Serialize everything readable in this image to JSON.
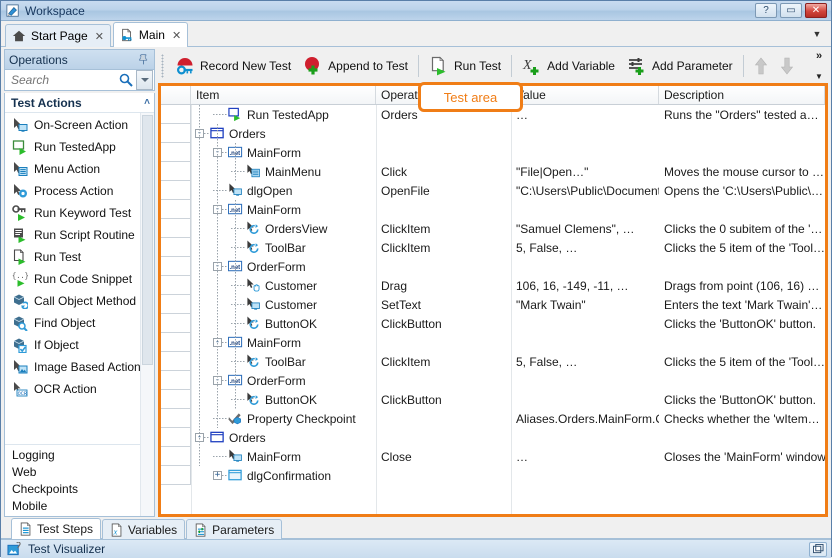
{
  "window": {
    "title": "Workspace",
    "icon": "pencil-document-icon",
    "buttons": [
      {
        "name": "help-button",
        "label": "?"
      },
      {
        "name": "restore-button",
        "label": "▭"
      },
      {
        "name": "close-button",
        "label": "✕"
      }
    ]
  },
  "tabs": [
    {
      "name": "tab-start-page",
      "label": "Start Page",
      "icon": "home-icon",
      "active": false,
      "close": "✕"
    },
    {
      "name": "tab-main",
      "label": "Main",
      "icon": "keyword-test-icon",
      "active": true,
      "close": "✕"
    }
  ],
  "tabstrip_caret": "▼",
  "operations_panel": {
    "title": "Operations",
    "pin_icon": "pin-icon",
    "search": {
      "value": "",
      "placeholder": "Search",
      "icon": "magnifier-icon",
      "dropdown": "▼"
    },
    "group_title": "Test Actions",
    "group_chevron": "˄",
    "items": [
      {
        "label": "On-Screen Action",
        "icon": "cursor-screen-icon"
      },
      {
        "label": "Run TestedApp",
        "icon": "run-app-icon"
      },
      {
        "label": "Menu Action",
        "icon": "cursor-menu-icon"
      },
      {
        "label": "Process Action",
        "icon": "cursor-gear-icon"
      },
      {
        "label": "Run Keyword Test",
        "icon": "key-run-icon"
      },
      {
        "label": "Run Script Routine",
        "icon": "script-run-icon"
      },
      {
        "label": "Run Test",
        "icon": "page-run-icon"
      },
      {
        "label": "Run Code Snippet",
        "icon": "code-run-icon"
      },
      {
        "label": "Call Object Method",
        "icon": "object-method-icon"
      },
      {
        "label": "Find Object",
        "icon": "object-find-icon"
      },
      {
        "label": "If Object",
        "icon": "object-if-icon"
      },
      {
        "label": "Image Based Action",
        "icon": "cursor-image-icon"
      },
      {
        "label": "OCR Action",
        "icon": "cursor-ocr-icon"
      }
    ],
    "footer_groups": [
      {
        "label": "Logging"
      },
      {
        "label": "Web"
      },
      {
        "label": "Checkpoints"
      },
      {
        "label": "Mobile"
      }
    ],
    "footer_chevron": "˅"
  },
  "toolbar": {
    "buttons": [
      {
        "name": "record-new-test-button",
        "label": "Record New Test",
        "icon": "record-key-icon"
      },
      {
        "name": "append-to-test-button",
        "label": "Append to Test",
        "icon": "append-plus-icon"
      },
      {
        "name": "run-test-button",
        "label": "Run Test",
        "icon": "page-run-icon"
      },
      {
        "name": "add-variable-button",
        "label": "Add Variable",
        "icon": "variable-x-plus-icon"
      },
      {
        "name": "add-parameter-button",
        "label": "Add Parameter",
        "icon": "parameter-sliders-plus-icon"
      }
    ],
    "move_up": {
      "name": "move-up-button",
      "icon": "arrow-up-icon"
    },
    "move_down": {
      "name": "move-down-button",
      "icon": "arrow-down-icon"
    },
    "overflow": {
      "double_chevron": "»",
      "down_caret": "▼"
    }
  },
  "callout": {
    "text": "Test area",
    "color": "#f07d16"
  },
  "grid": {
    "columns": [
      "Item",
      "Operation",
      "Value",
      "Description"
    ],
    "rows": [
      {
        "indent": 1,
        "expander": "",
        "icon": "run-app-icon",
        "item": "Run TestedApp",
        "operation": "Orders",
        "value": "…",
        "description": "Runs the \"Orders\" tested a…"
      },
      {
        "indent": 0,
        "expander": "-",
        "icon": "window-icon",
        "item": "Orders",
        "operation": "",
        "value": "",
        "description": ""
      },
      {
        "indent": 1,
        "expander": "-",
        "icon": "dotnet-icon",
        "item": "MainForm",
        "operation": "",
        "value": "",
        "description": ""
      },
      {
        "indent": 2,
        "expander": "",
        "icon": "cursor-menu-icon",
        "item": "MainMenu",
        "operation": "Click",
        "value": "\"File|Open…\"",
        "description": "Moves the mouse cursor to …"
      },
      {
        "indent": 1,
        "expander": "",
        "icon": "cursor-screen-icon",
        "item": "dlgOpen",
        "operation": "OpenFile",
        "value": "\"C:\\Users\\Public\\Documents…",
        "description": "Opens the 'C:\\Users\\Public\\…"
      },
      {
        "indent": 1,
        "expander": "-",
        "icon": "dotnet-icon",
        "item": "MainForm",
        "operation": "",
        "value": "",
        "description": ""
      },
      {
        "indent": 2,
        "expander": "",
        "icon": "cursor-click-icon",
        "item": "OrdersView",
        "operation": "ClickItem",
        "value": "\"Samuel Clemens\", …",
        "description": "Clicks the 0 subitem of the '…"
      },
      {
        "indent": 2,
        "expander": "",
        "icon": "cursor-click-icon",
        "item": "ToolBar",
        "operation": "ClickItem",
        "value": "5, False, …",
        "description": "Clicks the 5 item of the 'Tool…"
      },
      {
        "indent": 1,
        "expander": "-",
        "icon": "dotnet-icon",
        "item": "OrderForm",
        "operation": "",
        "value": "",
        "description": ""
      },
      {
        "indent": 2,
        "expander": "",
        "icon": "cursor-drag-icon",
        "item": "Customer",
        "operation": "Drag",
        "value": "106, 16, -149, -11, …",
        "description": "Drags from point (106, 16) …"
      },
      {
        "indent": 2,
        "expander": "",
        "icon": "cursor-screen-icon",
        "item": "Customer",
        "operation": "SetText",
        "value": "\"Mark Twain\"",
        "description": "Enters the text 'Mark Twain'…"
      },
      {
        "indent": 2,
        "expander": "",
        "icon": "cursor-click-icon",
        "item": "ButtonOK",
        "operation": "ClickButton",
        "value": "",
        "description": "Clicks the 'ButtonOK' button."
      },
      {
        "indent": 1,
        "expander": "-",
        "icon": "dotnet-icon",
        "item": "MainForm",
        "operation": "",
        "value": "",
        "description": ""
      },
      {
        "indent": 2,
        "expander": "",
        "icon": "cursor-click-icon",
        "item": "ToolBar",
        "operation": "ClickItem",
        "value": "5, False, …",
        "description": "Clicks the 5 item of the 'Tool…"
      },
      {
        "indent": 1,
        "expander": "-",
        "icon": "dotnet-icon",
        "item": "OrderForm",
        "operation": "",
        "value": "",
        "description": ""
      },
      {
        "indent": 2,
        "expander": "",
        "icon": "cursor-click-icon",
        "item": "ButtonOK",
        "operation": "ClickButton",
        "value": "",
        "description": "Clicks the 'ButtonOK' button."
      },
      {
        "indent": 1,
        "expander": "",
        "icon": "checkpoint-icon",
        "item": "Property Checkpoint",
        "operation": "",
        "value": "Aliases.Orders.MainForm.O…",
        "description": "Checks whether the 'wItem…"
      },
      {
        "indent": 0,
        "expander": "-",
        "icon": "window-icon",
        "item": "Orders",
        "operation": "",
        "value": "",
        "description": ""
      },
      {
        "indent": 1,
        "expander": "",
        "icon": "cursor-screen-icon",
        "item": "MainForm",
        "operation": "Close",
        "value": "…",
        "description": "Closes the 'MainForm' window."
      },
      {
        "indent": 1,
        "expander": "+",
        "icon": "window-blue-icon",
        "item": "dlgConfirmation",
        "operation": "",
        "value": "",
        "description": ""
      }
    ]
  },
  "bottom_tabs": [
    {
      "name": "tab-test-steps",
      "label": "Test Steps",
      "icon": "test-steps-icon",
      "active": true
    },
    {
      "name": "tab-variables",
      "label": "Variables",
      "icon": "variables-icon",
      "active": false
    },
    {
      "name": "tab-parameters",
      "label": "Parameters",
      "icon": "parameters-icon",
      "active": false
    }
  ],
  "visualizer": {
    "label": "Test Visualizer",
    "icon": "image-clip-icon",
    "button_icon": "restore-panel-icon"
  }
}
